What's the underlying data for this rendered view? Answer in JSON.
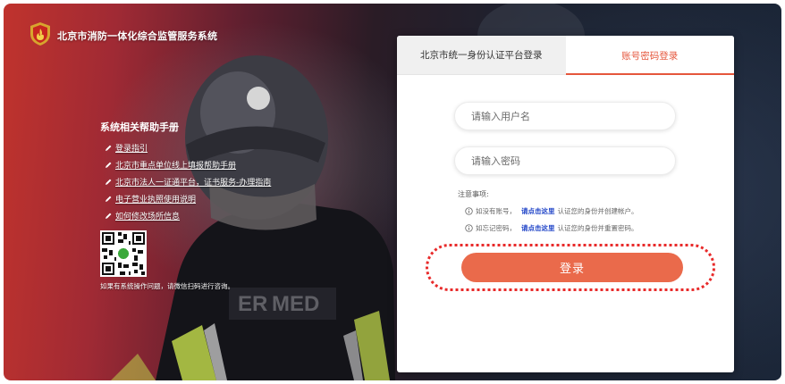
{
  "header": {
    "site_title": "北京市消防一体化综合监管服务系统",
    "emblem_icon": "fire-emblem-icon"
  },
  "help": {
    "title": "系统相关帮助手册",
    "links": [
      {
        "label": "登录指引",
        "icon": "pen-icon"
      },
      {
        "label": "北京市重点单位线上填报帮助手册",
        "icon": "pen-icon"
      },
      {
        "label": "北京市法人一证通平台，证书服务-办理指南",
        "icon": "pen-icon"
      },
      {
        "label": "电子营业执照使用说明",
        "icon": "pen-icon"
      },
      {
        "label": "如何修改场所信息",
        "icon": "pen-icon"
      }
    ],
    "qr_note": "如果有系统操作问题，请微信扫码进行咨询。"
  },
  "login": {
    "tabs": [
      {
        "label": "北京市统一身份认证平台登录",
        "active": false
      },
      {
        "label": "账号密码登录",
        "active": true
      }
    ],
    "username_placeholder": "请输入用户名",
    "username_value": "",
    "password_placeholder": "请输入密码",
    "password_value": "",
    "notice_title": "注意事项:",
    "notices": [
      {
        "before": "如没有账号，",
        "link": "请点击这里",
        "after": "认证您的身份并创建帐户。",
        "icon": "info-icon"
      },
      {
        "before": "如忘记密码，",
        "link": "请点击这里",
        "after": "认证您的身份并重置密码。",
        "icon": "info-icon"
      }
    ],
    "submit_label": "登录"
  },
  "colors": {
    "accent": "#e5563c",
    "button": "#ea6a4b",
    "link": "#2246c8",
    "highlight": "#e82a2a"
  }
}
